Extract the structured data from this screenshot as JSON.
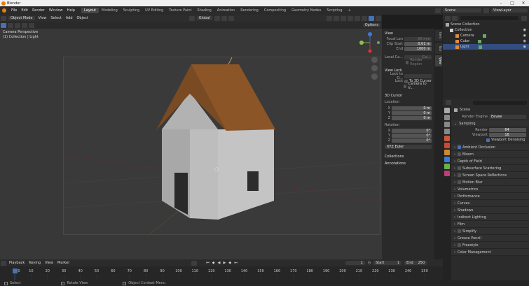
{
  "window": {
    "title": "Blender"
  },
  "menu": [
    "File",
    "Edit",
    "Render",
    "Window",
    "Help"
  ],
  "workspaces": [
    "Layout",
    "Modeling",
    "Sculpting",
    "UV Editing",
    "Texture Paint",
    "Shading",
    "Animation",
    "Rendering",
    "Compositing",
    "Geometry Nodes",
    "Scripting"
  ],
  "workspace_add": "+",
  "scene_field": "Scene",
  "viewlayer_field": "ViewLayer",
  "viewport_header": {
    "mode": "Object Mode",
    "menus": [
      "View",
      "Select",
      "Add",
      "Object"
    ],
    "orientation": "Global",
    "options": "Options"
  },
  "viewport": {
    "overlay_title": "Camera Perspective",
    "overlay_sub": "(1) Collection | Light"
  },
  "npanel": {
    "view_header": "View",
    "focal_label": "Focal Len",
    "focal_value": "50 mm",
    "clip_start_label": "Clip Start",
    "clip_start_value": "0.01 m",
    "clip_end_label": "End",
    "clip_end_value": "1000 m",
    "local_camera_label": "Local Ca...",
    "local_camera_value": "Ca...",
    "render_region": "Render Region",
    "viewlock_header": "View Lock",
    "lock_to_obj_label": "Lock to O...",
    "lock_label": "Lock",
    "to_3d_cursor": "To 3D Cursor",
    "camera_to_view": "Camera to V...",
    "cursor_header": "3D Cursor",
    "location_label": "Location",
    "loc_x": "0 m",
    "loc_y": "0 m",
    "loc_z": "0 m",
    "rotation_label": "Rotation",
    "rot_x": "0°",
    "rot_y": "0°",
    "rot_z": "0°",
    "rot_mode": "XYZ Euler",
    "collections": "Collections",
    "annotations": "Annotations",
    "axis_x": "X",
    "axis_y": "Y",
    "axis_z": "Z"
  },
  "ntabs": [
    "Item",
    "Tool",
    "View"
  ],
  "outliner": {
    "items": [
      {
        "label": "Scene Collection"
      },
      {
        "label": "Collection"
      },
      {
        "label": "Camera"
      },
      {
        "label": "Cube"
      },
      {
        "label": "Light"
      }
    ]
  },
  "props": {
    "scene_label": "Scene",
    "render_engine_label": "Render Engine",
    "render_engine_value": "Eevee",
    "sampling": "Sampling",
    "render_label": "Render",
    "render_value": "64",
    "viewport_label": "Viewport",
    "viewport_value": "16",
    "viewport_denoising": "Viewport Denoising",
    "sections": [
      "Ambient Occlusion",
      "Bloom",
      "Depth of Field",
      "Subsurface Scattering",
      "Screen Space Reflections",
      "Motion Blur",
      "Volumetrics",
      "Performance",
      "Curves",
      "Shadows",
      "Indirect Lighting",
      "Film",
      "Simplify",
      "Grease Pencil",
      "Freestyle",
      "Color Management"
    ]
  },
  "timeline": {
    "menus": [
      "Playback",
      "Keying",
      "View",
      "Marker"
    ],
    "current_frame": "1",
    "start_label": "Start",
    "start_value": "1",
    "end_label": "End",
    "end_value": "250",
    "ticks": [
      "0",
      "10",
      "20",
      "30",
      "40",
      "50",
      "60",
      "70",
      "80",
      "90",
      "100",
      "110",
      "120",
      "130",
      "140",
      "150",
      "160",
      "170",
      "180",
      "190",
      "200",
      "210",
      "220",
      "230",
      "240",
      "250"
    ]
  },
  "status": {
    "select": "Select",
    "rotate": "Rotate View",
    "context": "Object Context Menu"
  },
  "colors": {
    "accent": "#4772b3",
    "orange": "#e87d0d"
  }
}
